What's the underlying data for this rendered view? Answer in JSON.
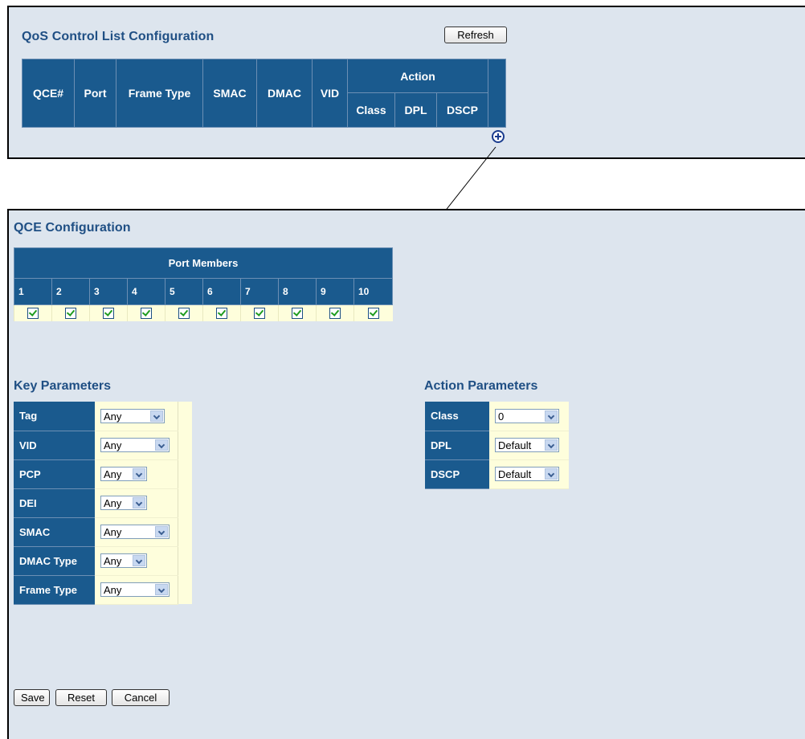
{
  "list_panel": {
    "title": "QoS Control List Configuration",
    "refresh_label": "Refresh",
    "columns": {
      "qce": "QCE#",
      "port": "Port",
      "frame_type": "Frame Type",
      "smac": "SMAC",
      "dmac": "DMAC",
      "vid": "VID",
      "action": "Action",
      "class": "Class",
      "dpl": "DPL",
      "dscp": "DSCP"
    },
    "add_icon": "plus-circle-icon"
  },
  "qce_panel": {
    "title": "QCE Configuration",
    "port_members": {
      "header": "Port Members",
      "ports": [
        {
          "label": "1",
          "checked": true
        },
        {
          "label": "2",
          "checked": true
        },
        {
          "label": "3",
          "checked": true
        },
        {
          "label": "4",
          "checked": true
        },
        {
          "label": "5",
          "checked": true
        },
        {
          "label": "6",
          "checked": true
        },
        {
          "label": "7",
          "checked": true
        },
        {
          "label": "8",
          "checked": true
        },
        {
          "label": "9",
          "checked": true
        },
        {
          "label": "10",
          "checked": true
        }
      ]
    },
    "key_parameters": {
      "title": "Key Parameters",
      "rows": [
        {
          "label": "Tag",
          "value": "Any"
        },
        {
          "label": "VID",
          "value": "Any"
        },
        {
          "label": "PCP",
          "value": "Any"
        },
        {
          "label": "DEI",
          "value": "Any"
        },
        {
          "label": "SMAC",
          "value": "Any"
        },
        {
          "label": "DMAC Type",
          "value": "Any"
        },
        {
          "label": "Frame Type",
          "value": "Any"
        }
      ]
    },
    "action_parameters": {
      "title": "Action Parameters",
      "rows": [
        {
          "label": "Class",
          "value": "0"
        },
        {
          "label": "DPL",
          "value": "Default"
        },
        {
          "label": "DSCP",
          "value": "Default"
        }
      ]
    },
    "buttons": {
      "save": "Save",
      "reset": "Reset",
      "cancel": "Cancel"
    }
  },
  "colors": {
    "panel_bg": "#dde5ee",
    "header_bg": "#1a5a8e",
    "title_text": "#1f4f84",
    "value_bg": "#fefedc"
  }
}
